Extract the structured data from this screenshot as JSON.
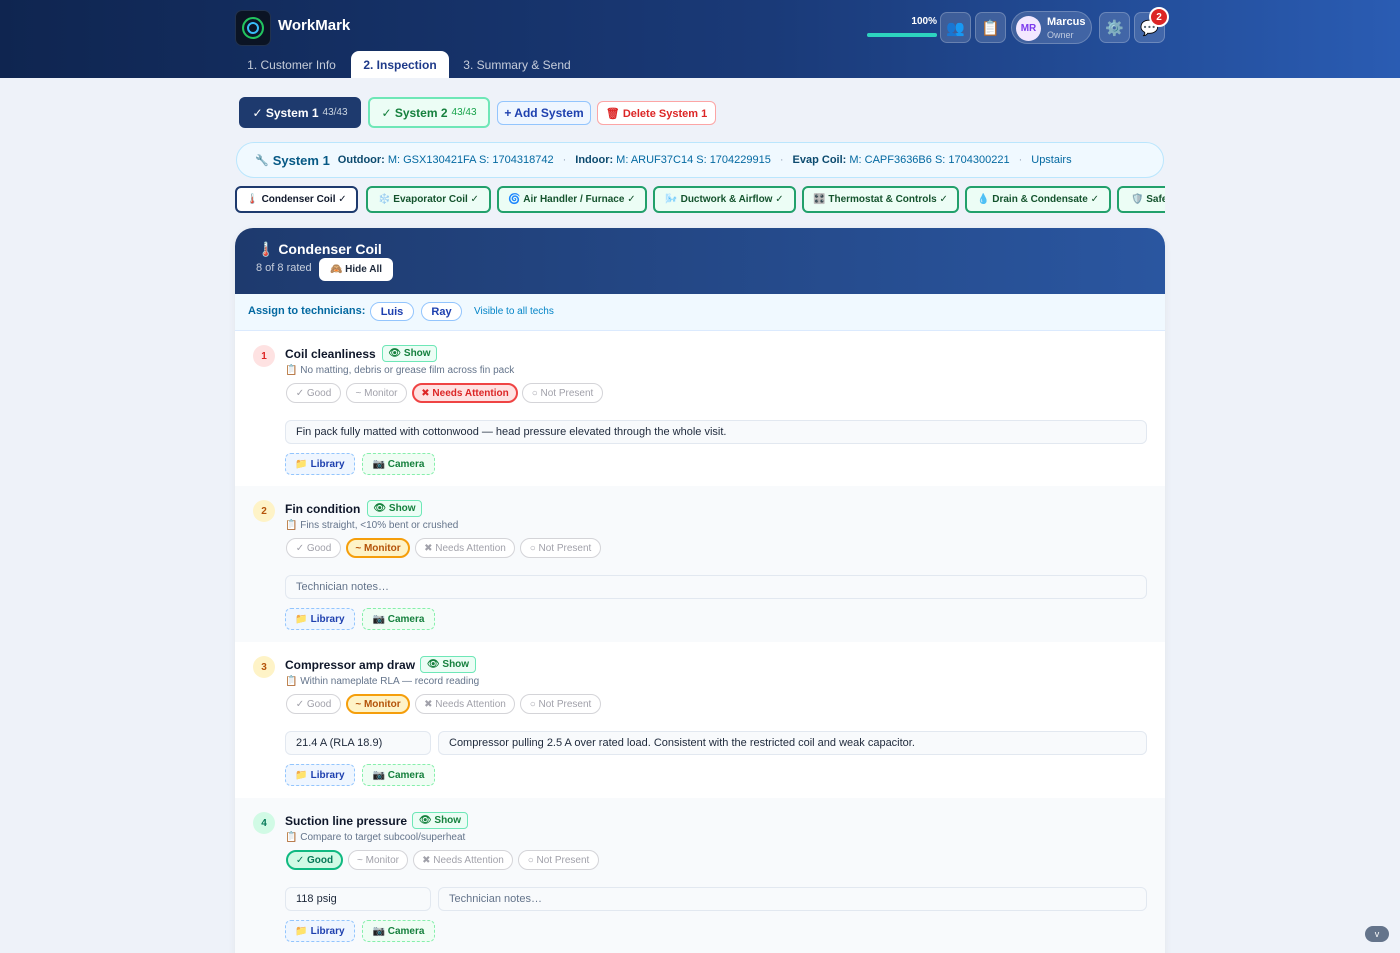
{
  "app": {
    "title": "WorkMark",
    "progress_label": "100%",
    "progress_fraction": 1.0
  },
  "header": {
    "icons": [
      "team-icon",
      "clipboard-icon",
      "settings-icon",
      "chat-icon"
    ],
    "user": {
      "initials": "MR",
      "name": "Marcus",
      "role": "Owner"
    },
    "notifications": "2"
  },
  "tabs": [
    {
      "label": "1. Customer Info",
      "active": false
    },
    {
      "label": "2. Inspection",
      "active": true
    },
    {
      "label": "3. Summary & Send",
      "active": false
    }
  ],
  "systems": {
    "sys1": {
      "label": "✓ System 1",
      "count": "43/43"
    },
    "sys2": {
      "label": "✓ System 2",
      "count": "43/43"
    },
    "add_label": "+ Add System",
    "delete_label": "🗑 Delete System 1"
  },
  "system_info": {
    "name": "System 1",
    "outdoor_label": "Outdoor:",
    "outdoor_value": "M: GSX130421FA S: 1704318742",
    "indoor_label": "Indoor:",
    "indoor_value": "M: ARUF37C14 S: 1704229915",
    "evap_label": "Evap Coil:",
    "evap_value": "M: CAPF3636B6 S: 1704300221",
    "location": "Upstairs"
  },
  "categories": [
    "🌡️ Condenser Coil ✓",
    "❄️ Evaporator Coil ✓",
    "🌀 Air Handler / Furnace ✓",
    "🌬️ Ductwork & Airflow ✓",
    "🎛️ Thermostat & Controls ✓",
    "💧 Drain & Condensate ✓",
    "🛡️ Safe"
  ],
  "section": {
    "title": "🌡️ Condenser Coil",
    "rated": "8 of 8 rated",
    "hide_all": "🙈 Hide All",
    "assign_label": "Assign to technicians:",
    "techs": [
      "Luis",
      "Ray"
    ],
    "visible_note": "Visible to all techs"
  },
  "ratings": [
    "✓ Good",
    "~ Monitor",
    "✖ Needs Attention",
    "○ Not Present"
  ],
  "media": {
    "library": "📁 Library",
    "camera": "📷 Camera"
  },
  "items": [
    {
      "num": "1",
      "name": "Coil cleanliness",
      "show": "👁 Show",
      "hint": "📋 No matting, debris or grease film across fin pack",
      "selected": "Needs Attention",
      "notes": "Fin pack fully matted with cottonwood — head pressure elevated through the whole visit."
    },
    {
      "num": "2",
      "name": "Fin condition",
      "show": "👁 Show",
      "hint": "📋 Fins straight, <10% bent or crushed",
      "selected": "Monitor",
      "notes_placeholder": "Technician notes…"
    },
    {
      "num": "3",
      "name": "Compressor amp draw",
      "show": "👁 Show",
      "hint": "📋 Within nameplate RLA — record reading",
      "selected": "Monitor",
      "reading": "21.4 A (RLA 18.9)",
      "notes": "Compressor pulling 2.5 A over rated load. Consistent with the restricted coil and weak capacitor."
    },
    {
      "num": "4",
      "name": "Suction line pressure",
      "show": "👁 Show",
      "hint": "📋 Compare to target subcool/superheat",
      "selected": "Good",
      "reading": "118 psig",
      "notes_placeholder": "Technician notes…"
    }
  ],
  "scroll_hint": "v"
}
